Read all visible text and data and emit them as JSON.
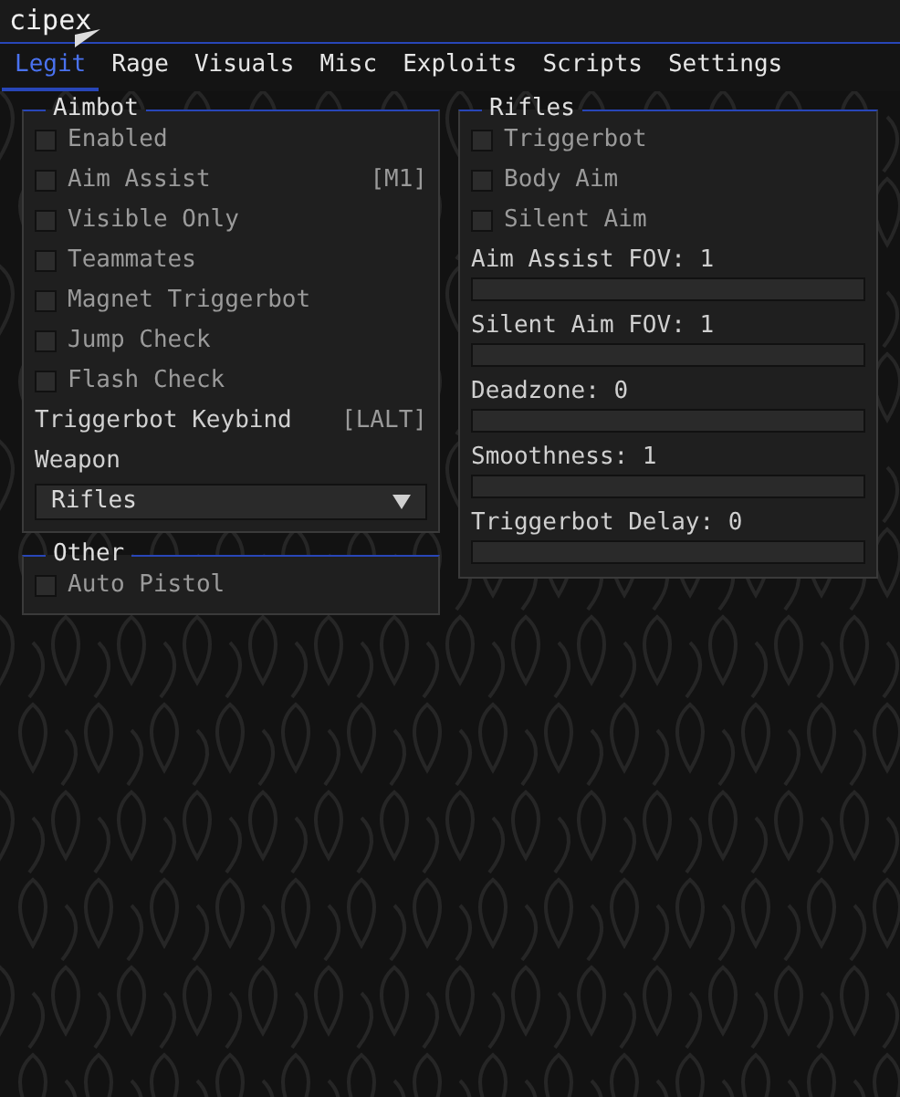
{
  "window": {
    "title": "cipex"
  },
  "tabs": [
    {
      "label": "Legit",
      "selected": true
    },
    {
      "label": "Rage",
      "selected": false
    },
    {
      "label": "Visuals",
      "selected": false
    },
    {
      "label": "Misc",
      "selected": false
    },
    {
      "label": "Exploits",
      "selected": false
    },
    {
      "label": "Scripts",
      "selected": false
    },
    {
      "label": "Settings",
      "selected": false
    }
  ],
  "left_groups": [
    {
      "title": "Aimbot",
      "items": [
        {
          "kind": "checkbox",
          "label": "Enabled",
          "checked": false
        },
        {
          "kind": "checkbox",
          "label": "Aim Assist",
          "checked": false,
          "keybind": "[M1]"
        },
        {
          "kind": "checkbox",
          "label": "Visible Only",
          "checked": false
        },
        {
          "kind": "checkbox",
          "label": "Teammates",
          "checked": false
        },
        {
          "kind": "checkbox",
          "label": "Magnet Triggerbot",
          "checked": false
        },
        {
          "kind": "checkbox",
          "label": "Jump Check",
          "checked": false
        },
        {
          "kind": "checkbox",
          "label": "Flash Check",
          "checked": false
        },
        {
          "kind": "keybind",
          "label": "Triggerbot Keybind",
          "keybind": "[LALT]"
        },
        {
          "kind": "label",
          "label": "Weapon"
        },
        {
          "kind": "dropdown",
          "value": "Rifles"
        }
      ]
    },
    {
      "title": "Other",
      "items": [
        {
          "kind": "checkbox",
          "label": "Auto Pistol",
          "checked": false
        }
      ]
    }
  ],
  "right_groups": [
    {
      "title": "Rifles",
      "items": [
        {
          "kind": "checkbox",
          "label": "Triggerbot",
          "checked": false
        },
        {
          "kind": "checkbox",
          "label": "Body Aim",
          "checked": false
        },
        {
          "kind": "checkbox",
          "label": "Silent Aim",
          "checked": false
        },
        {
          "kind": "slider",
          "label": "Aim Assist FOV: 1",
          "level": 0
        },
        {
          "kind": "slider",
          "label": "Silent Aim FOV: 1",
          "level": 0
        },
        {
          "kind": "slider",
          "label": "Deadzone: 0",
          "level": 0
        },
        {
          "kind": "slider",
          "label": "Smoothness: 1",
          "level": 0
        },
        {
          "kind": "slider",
          "label": "Triggerbot Delay: 0",
          "level": 0
        }
      ]
    }
  ]
}
